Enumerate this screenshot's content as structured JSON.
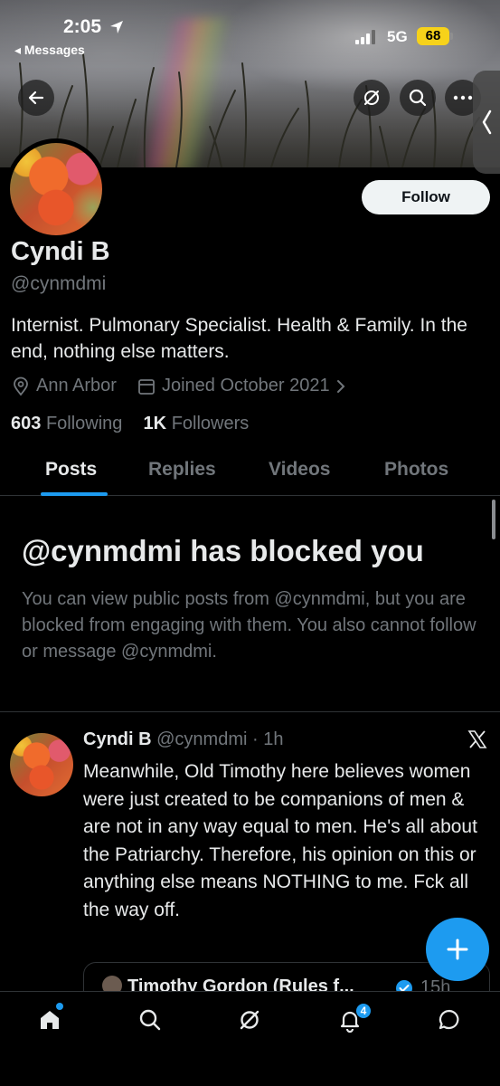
{
  "status_bar": {
    "time": "2:05",
    "back_app": "◂ Messages",
    "network": "5G",
    "battery": "68"
  },
  "profile": {
    "name": "Cyndi B",
    "handle": "@cynmdmi",
    "bio": "Internist. Pulmonary Specialist. Health & Family. In the end, nothing else matters.",
    "location": "Ann Arbor",
    "joined": "Joined October 2021",
    "following_count": "603",
    "following_label": "Following",
    "followers_count": "1K",
    "followers_label": "Followers",
    "follow_button": "Follow"
  },
  "tabs": [
    {
      "label": "Posts",
      "active": true
    },
    {
      "label": "Replies",
      "active": false
    },
    {
      "label": "Videos",
      "active": false
    },
    {
      "label": "Photos",
      "active": false
    }
  ],
  "blocked": {
    "title": "@cynmdmi has blocked you",
    "description": "You can view public posts from @cynmdmi, but you are blocked from engaging with them. You also cannot follow or message @cynmdmi."
  },
  "post": {
    "author": "Cyndi B",
    "handle_time": "@cynmdmi · 1h",
    "text": "Meanwhile, Old Timothy here believes women were just created to be companions of men & are not in any way equal to men.  He's all about the Patriarchy.  Therefore, his opinion on this or anything else means NOTHING to me. Fck all the way off.",
    "quote": {
      "author": "Timothy Gordon (Rules f...",
      "time": "15h"
    }
  },
  "nav": {
    "notifications_badge": "4"
  },
  "colors": {
    "accent": "#1d9bf0",
    "muted": "#71767b",
    "text": "#e7e9ea",
    "battery": "#f6d21a"
  }
}
